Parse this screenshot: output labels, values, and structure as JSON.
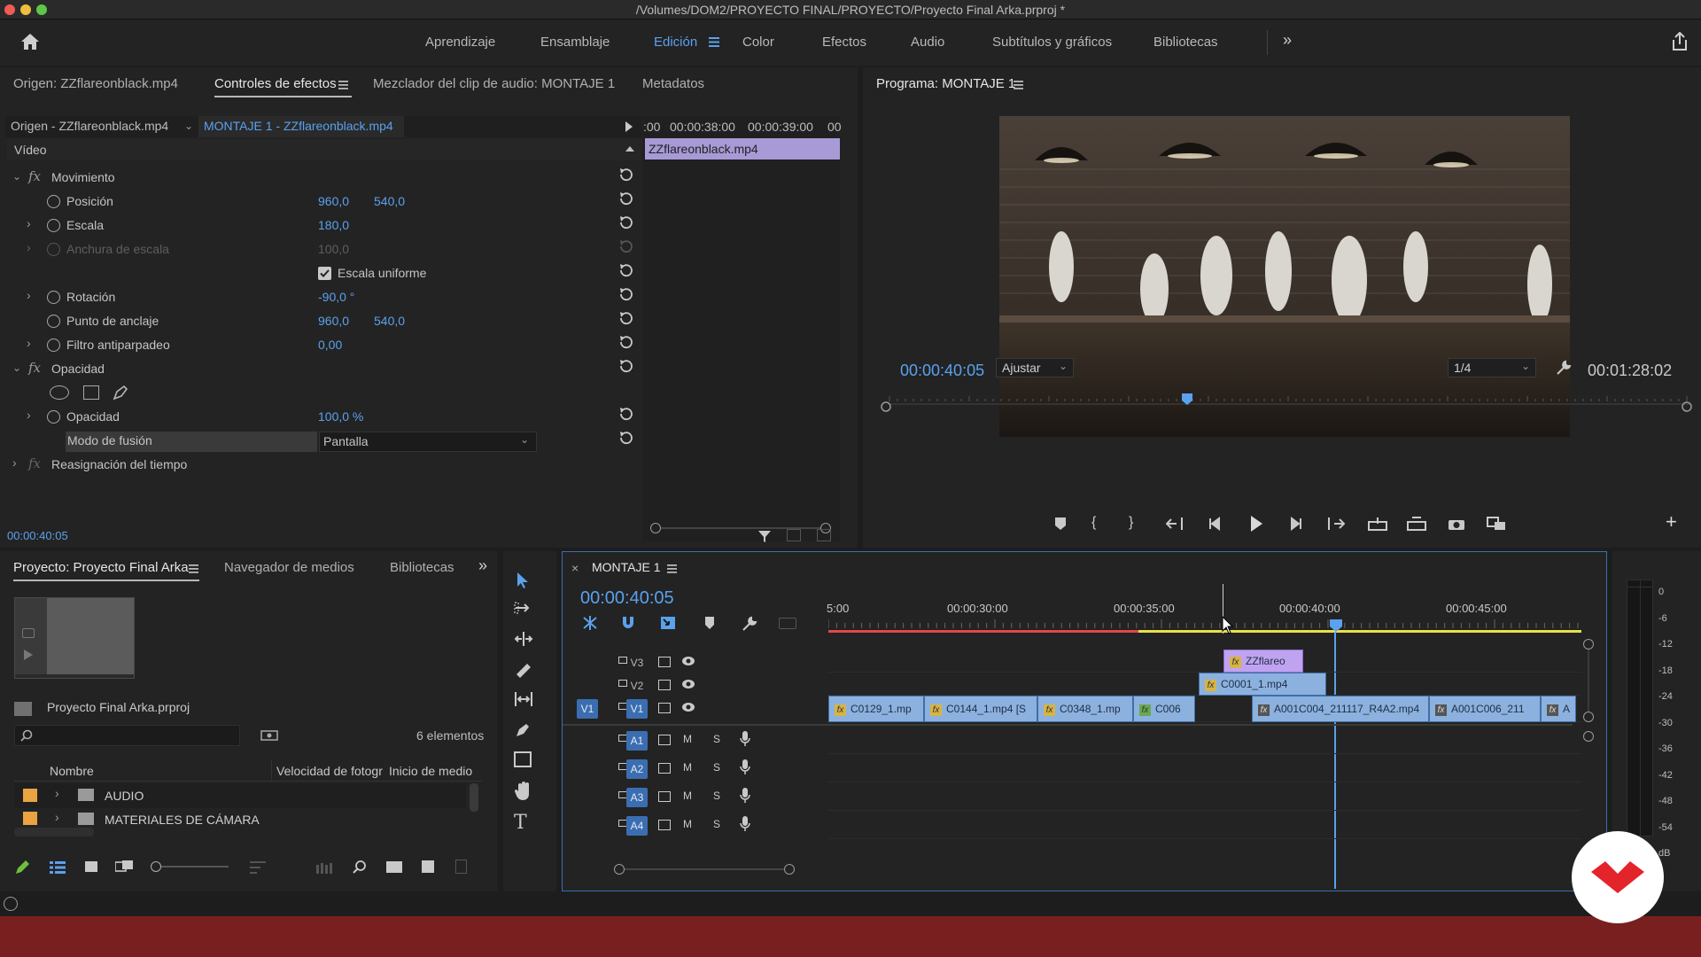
{
  "window": {
    "title": "/Volumes/DOM2/PROYECTO FINAL/PROYECTO/Proyecto Final Arka.prproj *"
  },
  "workspaces": [
    "Aprendizaje",
    "Ensamblaje",
    "Edición",
    "Color",
    "Efectos",
    "Audio",
    "Subtítulos y gráficos",
    "Bibliotecas"
  ],
  "source_panel": {
    "tabs": [
      "Origen: ZZflareonblack.mp4",
      "Controles de efectos",
      "Mezclador del clip de audio: MONTAJE 1",
      "Metadatos"
    ],
    "source_label": "Origen - ZZflareonblack.mp4",
    "sequence_label": "MONTAJE 1 - ZZflareonblack.mp4",
    "ruler": [
      ":00",
      "00:00:38:00",
      "00:00:39:00",
      "00"
    ],
    "clip_name": "ZZflareonblack.mp4",
    "video_label": "Vídeo",
    "motion": "Movimiento",
    "position": {
      "label": "Posición",
      "x": "960,0",
      "y": "540,0"
    },
    "scale": {
      "label": "Escala",
      "value": "180,0"
    },
    "scale_width": {
      "label": "Anchura de escala",
      "value": "100,0"
    },
    "uniform": "Escala uniforme",
    "rotation": {
      "label": "Rotación",
      "value": "-90,0 °"
    },
    "anchor": {
      "label": "Punto de anclaje",
      "x": "960,0",
      "y": "540,0"
    },
    "flicker": {
      "label": "Filtro antiparpadeo",
      "value": "0,00"
    },
    "opacity_group": "Opacidad",
    "opacity": {
      "label": "Opacidad",
      "value": "100,0 %"
    },
    "blend": {
      "label": "Modo de fusión",
      "value": "Pantalla"
    },
    "time_remap": "Reasignación del tiempo",
    "timecode": "00:00:40:05"
  },
  "program": {
    "title": "Programa: MONTAJE 1",
    "timecode": "00:00:40:05",
    "fit": "Ajustar",
    "resolution": "1/4",
    "duration": "00:01:28:02"
  },
  "project": {
    "tabs": [
      "Proyecto: Proyecto Final Arka",
      "Navegador de medios",
      "Bibliotecas"
    ],
    "file": "Proyecto Final Arka.prproj",
    "count": "6 elementos",
    "columns": [
      "Nombre",
      "Velocidad de fotogr",
      "Inicio de medio"
    ],
    "items": [
      {
        "name": "AUDIO",
        "color": "#e9a441"
      },
      {
        "name": "MATERIALES DE CÁMARA",
        "color": "#e9a441"
      }
    ]
  },
  "timeline": {
    "name": "MONTAJE 1",
    "timecode": "00:00:40:05",
    "ruler": [
      "5:00",
      "00:00:30:00",
      "00:00:35:00",
      "00:00:40:00",
      "00:00:45:00"
    ],
    "tracks": {
      "video": [
        "V3",
        "V2",
        "V1"
      ],
      "audio": [
        "A1",
        "A2",
        "A3",
        "A4"
      ],
      "source_v": "V1"
    },
    "clips_v3": [
      "ZZflareo"
    ],
    "clips_v2": [
      "C0001_1.mp4"
    ],
    "clips_v1": [
      "C0129_1.mp",
      "C0144_1.mp4 [S",
      "C0348_1.mp",
      "C006",
      "A001C004_211117_R4A2.mp4",
      "A001C006_211",
      "A"
    ]
  },
  "meter": {
    "scale": [
      "0",
      "-6",
      "-12",
      "-18",
      "-24",
      "-30",
      "-36",
      "-42",
      "-48",
      "-54",
      "dB"
    ]
  },
  "colors": {
    "accent": "#5aa1ee",
    "bottom_bar": "#7a1f1f",
    "logo": "#e3242b"
  }
}
